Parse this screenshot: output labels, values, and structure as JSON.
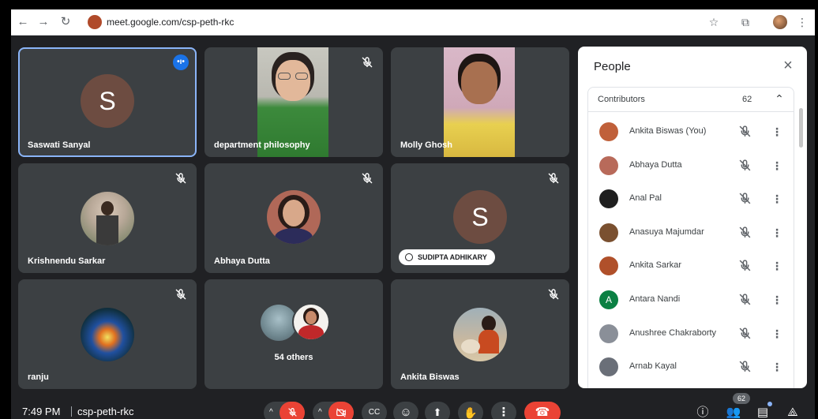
{
  "browser": {
    "url": "meet.google.com/csp-peth-rkc"
  },
  "tiles": [
    {
      "name": "Saswati Sanyal",
      "letter": "S"
    },
    {
      "name": "department philosophy"
    },
    {
      "name": "Molly Ghosh"
    },
    {
      "name": "Krishnendu Sarkar"
    },
    {
      "name": "Abhaya Dutta"
    },
    {
      "name": "SUDIPTA ADHIKARY",
      "letter": "S"
    },
    {
      "name": "ranju"
    },
    {
      "name": "54 others"
    },
    {
      "name": "Ankita Biswas"
    }
  ],
  "people_panel": {
    "title": "People",
    "section_label": "Contributors",
    "section_count": "62",
    "participants": [
      {
        "name": "Ankita Biswas (You)",
        "color": "#c0603a"
      },
      {
        "name": "Abhaya Dutta",
        "color": "#b86a5a"
      },
      {
        "name": "Anal Pal",
        "color": "#1f1f1f"
      },
      {
        "name": "Anasuya Majumdar",
        "color": "#7a5030"
      },
      {
        "name": "Ankita Sarkar",
        "color": "#b0502a"
      },
      {
        "name": "Antara Nandi",
        "letter": "A",
        "color": "#0b8043"
      },
      {
        "name": "Anushree Chakraborty",
        "color": "#8a8f98"
      },
      {
        "name": "Arnab Kayal",
        "color": "#6a6f78"
      }
    ]
  },
  "bottom_bar": {
    "time": "7:49 PM",
    "meeting_code": "csp-peth-rkc",
    "people_count": "62"
  },
  "colors": {
    "accent": "#8ab4f8",
    "end_call": "#ea4335",
    "mic_off": "#ea4335"
  }
}
